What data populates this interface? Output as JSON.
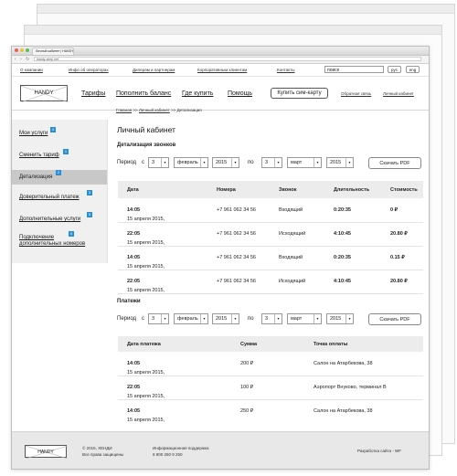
{
  "browser": {
    "tab_title": "Личный кабинет | HANDY",
    "address": "handy-simp.net",
    "nav_back": "‹",
    "nav_forward": "›",
    "nav_reload": "↻"
  },
  "topnav": {
    "links": [
      "О компании",
      "Инфо об операторах",
      "Дилерам и партнерам",
      "Корпоративным клиентам",
      "Контакты"
    ],
    "search_value": "поиск",
    "lang": [
      "рус",
      "eng"
    ]
  },
  "header": {
    "logo": "HANDY",
    "menu": [
      "Тарифы",
      "Пополнить баланс",
      "Где купить",
      "Помощь"
    ],
    "buy_sim": "Купить сим-карту",
    "feedback": "Обратная связь",
    "cabinet": "Личный кабинет"
  },
  "breadcrumb": {
    "home": "Главная",
    "sep": ">>",
    "cabinet": "Личный кабинет",
    "current": "Детализация"
  },
  "sidebar": {
    "items": [
      {
        "label": "Мои услуги",
        "badge": "4"
      },
      {
        "label": "Сменить тариф",
        "badge": "1"
      },
      {
        "label": "Детализация",
        "badge": "2"
      },
      {
        "label": "Доверительный платеж",
        "badge": "3"
      },
      {
        "label": "Дополнительные услуги",
        "badge": "5"
      },
      {
        "label": "Подключение дополнительных номеров",
        "badge": "6"
      }
    ]
  },
  "page": {
    "title": "Личный кабинет",
    "calls_title": "Детализация звонков",
    "payments_title": "Платежи"
  },
  "period": {
    "label": "Период",
    "from": "с",
    "to": "по",
    "from_day": "3",
    "from_month": "февраль",
    "from_year": "2015",
    "to_day": "3",
    "to_month": "март",
    "to_year": "2015",
    "pdf": "Скачать PDF"
  },
  "calls": {
    "columns": [
      "Дата",
      "Номера",
      "Звонок",
      "Длительность",
      "Стоимость"
    ],
    "rows": [
      {
        "date": "15 апреля 2015,",
        "time": "14:05",
        "number": "+7 961 062 34 56",
        "type": "Входящий",
        "duration": "0:20:35",
        "cost": "0 ₽"
      },
      {
        "date": "15 апреля 2015,",
        "time": "22:05",
        "number": "+7 961 062 34 56",
        "type": "Исходящий",
        "duration": "4:10:45",
        "cost": "20.80 ₽"
      },
      {
        "date": "15 апреля 2015,",
        "time": "14:05",
        "number": "+7 961 062 34 56",
        "type": "Входящий",
        "duration": "0:20:35",
        "cost": "0.15 ₽"
      },
      {
        "date": "15 апреля 2015,",
        "time": "22:05",
        "number": "+7 961 062 34 56",
        "type": "Исходящий",
        "duration": "4:10:45",
        "cost": "20.80 ₽"
      }
    ]
  },
  "payments": {
    "columns": [
      "Дата платежа",
      "Сумма",
      "Точка оплаты"
    ],
    "rows": [
      {
        "date": "15 апреля 2015,",
        "time": "14:05",
        "amount": "200 ₽",
        "place": "Салон на Атарбекова, 38"
      },
      {
        "date": "15 апреля 2015,",
        "time": "22:05",
        "amount": "100 ₽",
        "place": "Аэропорт Внуково, терминал В"
      },
      {
        "date": "15 апреля 2015,",
        "time": "14:05",
        "amount": "250 ₽",
        "place": "Салон на Атарбекова, 38"
      }
    ]
  },
  "footer": {
    "logo": "HANDY",
    "copyright": "© 2015, ХЕНДИ",
    "rights": "Все права защищены",
    "support_label": "Информационная поддержка",
    "support_phone": "8 800 250 9 250",
    "dev": "Разработка сайта - WF"
  }
}
